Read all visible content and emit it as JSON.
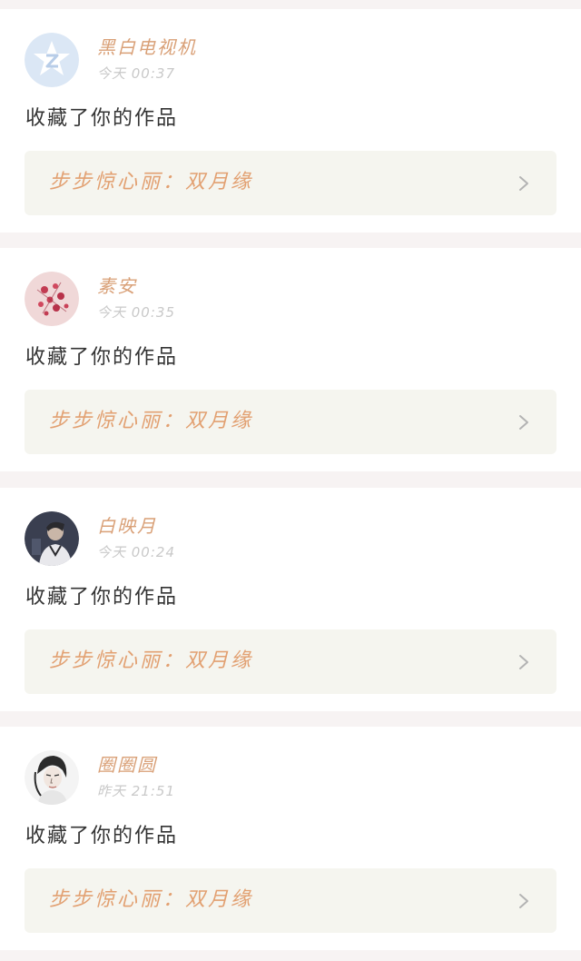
{
  "notifications": [
    {
      "user": "黑白电视机",
      "time": "今天 00:37",
      "action": "收藏了你的作品",
      "work_title": "步步惊心丽：双月缘",
      "avatar_icon": "default-star-avatar-icon",
      "avatar_color": "#dbe7f5"
    },
    {
      "user": "素安",
      "time": "今天 00:35",
      "action": "收藏了你的作品",
      "work_title": "步步惊心丽：双月缘",
      "avatar_icon": "red-flowers-avatar-icon",
      "avatar_color": "#f0d8d8"
    },
    {
      "user": "白映月",
      "time": "今天 00:24",
      "action": "收藏了你的作品",
      "work_title": "步步惊心丽：双月缘",
      "avatar_icon": "portrait-avatar-icon",
      "avatar_color": "#3a3f50"
    },
    {
      "user": "圈圈圆",
      "time": "昨天 21:51",
      "action": "收藏了你的作品",
      "work_title": "步步惊心丽：双月缘",
      "avatar_icon": "sketch-portrait-avatar-icon",
      "avatar_color": "#f4f4f4"
    }
  ],
  "colors": {
    "username": "#d9a077",
    "work_title": "#e2a071",
    "time": "#c9c9c9",
    "card_link_bg": "#f5f5ef",
    "page_bg": "#f7f3f3"
  }
}
